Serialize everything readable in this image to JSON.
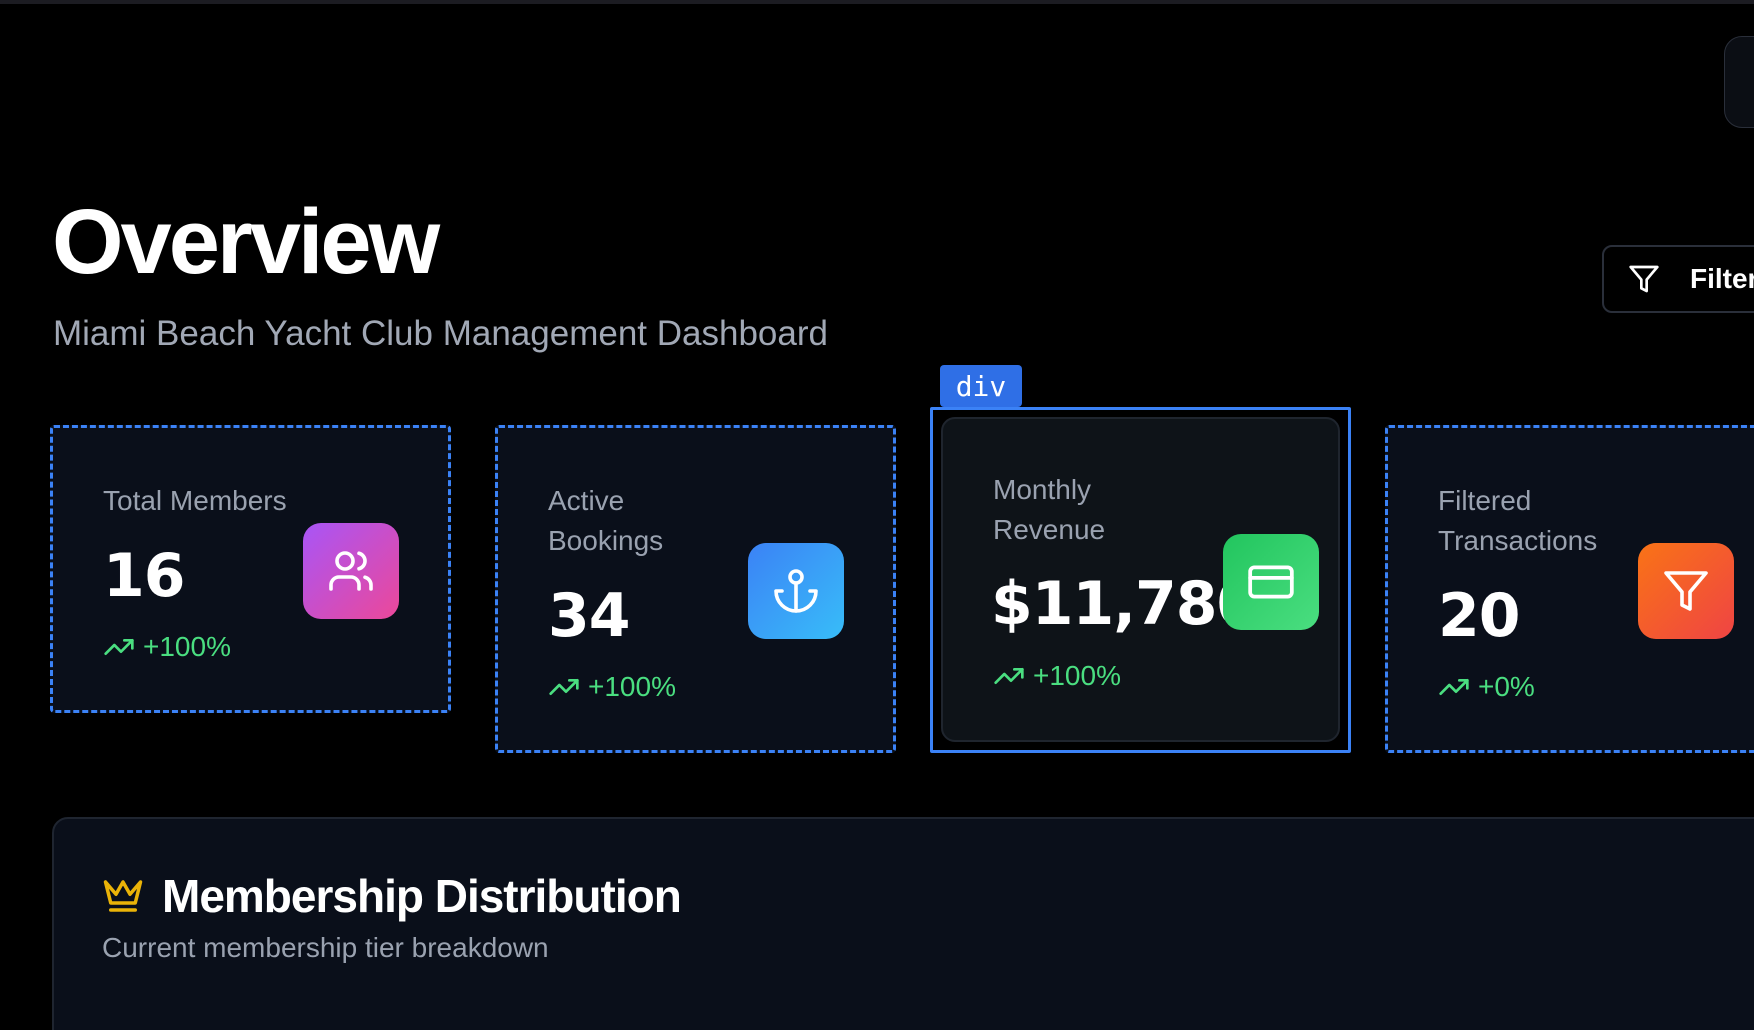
{
  "header": {
    "title": "Overview",
    "subtitle": "Miami Beach Yacht Club Management Dashboard",
    "filter_label": "Filter"
  },
  "inspector": {
    "selected_tag": "div"
  },
  "stats": [
    {
      "label_line1": "Total Members",
      "label_line2": "",
      "value": "16",
      "change": "+100%",
      "icon": "users-icon",
      "icon_color": "#a855f7"
    },
    {
      "label_line1": "Active",
      "label_line2": "Bookings",
      "value": "34",
      "change": "+100%",
      "icon": "anchor-icon",
      "icon_color": "#3b82f6"
    },
    {
      "label_line1": "Monthly",
      "label_line2": "Revenue",
      "value": "$11,780",
      "change": "+100%",
      "icon": "credit-card-icon",
      "icon_color": "#22c55e"
    },
    {
      "label_line1": "Filtered",
      "label_line2": "Transactions",
      "value": "20",
      "change": "+0%",
      "icon": "filter-icon",
      "icon_color": "#f97316"
    }
  ],
  "membership_panel": {
    "title": "Membership Distribution",
    "subtitle": "Current membership tier breakdown",
    "icon": "crown-icon"
  },
  "colors": {
    "background": "#000000",
    "card_background": "#0a0f1a",
    "selection_blue": "#3b82f6",
    "trend_green": "#4ade80",
    "crown_gold": "#eab308"
  }
}
